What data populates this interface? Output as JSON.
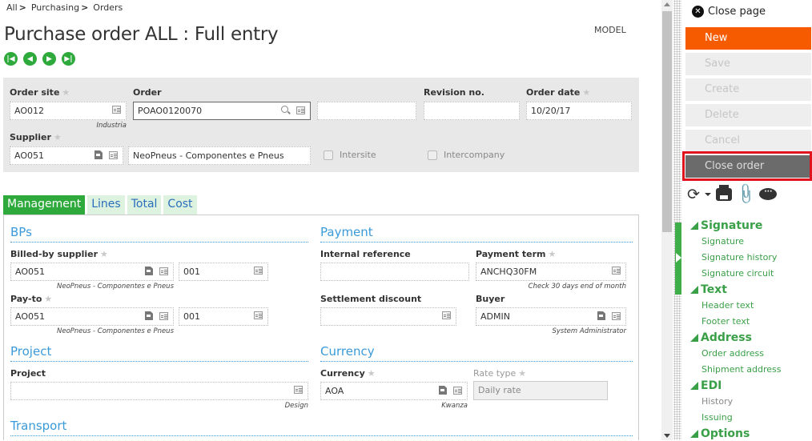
{
  "breadcrumb": [
    {
      "label": "All",
      "sep": ">"
    },
    {
      "label": "Purchasing",
      "sep": ">"
    },
    {
      "label": "Orders",
      "sep": ""
    }
  ],
  "page_title": "Purchase order ALL : Full entry",
  "model_label": "MODEL",
  "nav_icons": [
    "first-record-icon",
    "previous-record-icon",
    "next-record-icon",
    "last-record-icon"
  ],
  "header": {
    "order_site": {
      "label": "Order site",
      "value": "AO012",
      "sub": "Industria"
    },
    "order": {
      "label": "Order",
      "value": "POAO0120070"
    },
    "order_extra": {
      "value": ""
    },
    "revision_no": {
      "label": "Revision no.",
      "value": ""
    },
    "order_date": {
      "label": "Order date",
      "value": "10/20/17"
    },
    "supplier": {
      "label": "Supplier",
      "value": "AO051",
      "name": "NeoPneus - Componentes e Pneus"
    },
    "intersite": {
      "label": "Intersite",
      "checked": false
    },
    "intercompany": {
      "label": "Intercompany",
      "checked": false
    }
  },
  "tabs": [
    {
      "label": "Management",
      "active": true
    },
    {
      "label": "Lines",
      "active": false
    },
    {
      "label": "Total",
      "active": false
    },
    {
      "label": "Cost",
      "active": false
    }
  ],
  "sections": {
    "bps": {
      "title": "BPs",
      "billed_by": {
        "label": "Billed-by supplier",
        "value": "AO051",
        "address": "001",
        "sub": "NeoPneus - Componentes e Pneus"
      },
      "pay_to": {
        "label": "Pay-to",
        "value": "AO051",
        "address": "001",
        "sub": "NeoPneus - Componentes e Pneus"
      }
    },
    "payment": {
      "title": "Payment",
      "internal_reference": {
        "label": "Internal reference",
        "value": ""
      },
      "payment_term": {
        "label": "Payment term",
        "value": "ANCHQ30FM",
        "sub": "Check 30 days end of month"
      },
      "settlement_discount": {
        "label": "Settlement discount",
        "value": ""
      },
      "buyer": {
        "label": "Buyer",
        "value": "ADMIN",
        "sub": "System Administrator"
      }
    },
    "project": {
      "title": "Project",
      "project": {
        "label": "Project",
        "value": "",
        "sub": "Design"
      }
    },
    "currency": {
      "title": "Currency",
      "currency": {
        "label": "Currency",
        "value": "AOA",
        "sub": "Kwanza"
      },
      "rate_type": {
        "label": "Rate type",
        "value": "Daily rate"
      }
    },
    "transport": {
      "title": "Transport"
    }
  },
  "side": {
    "close_page": "Close page",
    "buttons": {
      "new": "New",
      "save": "Save",
      "create": "Create",
      "delete": "Delete",
      "cancel": "Cancel",
      "close_order": "Close order"
    },
    "menu": [
      {
        "group": "Signature",
        "items": [
          {
            "label": "Signature",
            "enabled": true
          },
          {
            "label": "Signature history",
            "enabled": true
          },
          {
            "label": "Signature circuit",
            "enabled": true
          }
        ]
      },
      {
        "group": "Text",
        "items": [
          {
            "label": "Header text",
            "enabled": true
          },
          {
            "label": "Footer text",
            "enabled": true
          }
        ]
      },
      {
        "group": "Address",
        "items": [
          {
            "label": "Order address",
            "enabled": true
          },
          {
            "label": "Shipment address",
            "enabled": true
          }
        ]
      },
      {
        "group": "EDI",
        "items": [
          {
            "label": "History",
            "enabled": false
          },
          {
            "label": "Issuing",
            "enabled": true
          }
        ]
      },
      {
        "group": "Options",
        "items": []
      }
    ]
  },
  "colors": {
    "accent_green": "#2eaa3c",
    "new_button": "#f75b00",
    "section_title": "#3a9ad9",
    "highlight_border": "#e0141e"
  }
}
